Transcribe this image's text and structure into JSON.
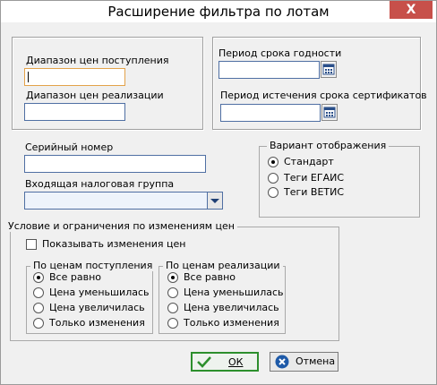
{
  "window": {
    "title": "Расширение фильтра по лотам",
    "close_glyph": "X"
  },
  "left_top": {
    "purchase_price_range_label": "Диапазон цен поступления",
    "purchase_price_range_value": "",
    "sale_price_range_label": "Диапазон цен реализации",
    "sale_price_range_value": ""
  },
  "right_top": {
    "expiry_label": "Период срока годности",
    "expiry_value": "",
    "cert_label": "Период истечения срока сертификатов",
    "cert_value": ""
  },
  "mid": {
    "serial_label": "Серийный номер",
    "serial_value": "",
    "tax_group_label": "Входящая налоговая группа",
    "tax_group_value": ""
  },
  "display": {
    "legend": "Вариант отображения",
    "options": [
      {
        "label": "Стандарт",
        "selected": true
      },
      {
        "label": "Теги ЕГАИС",
        "selected": false
      },
      {
        "label": "Теги ВЕТИС",
        "selected": false
      }
    ]
  },
  "price_changes": {
    "legend": "Условие и ограничения по изменениям цен",
    "show_changes_label": "Показывать изменения цен",
    "show_changes_checked": false,
    "purchase": {
      "legend": "По ценам поступления",
      "options": [
        {
          "label": "Все равно",
          "selected": true
        },
        {
          "label": "Цена уменьшилась",
          "selected": false
        },
        {
          "label": "Цена увеличилась",
          "selected": false
        },
        {
          "label": "Только изменения",
          "selected": false
        }
      ]
    },
    "sale": {
      "legend": "По ценам реализации",
      "options": [
        {
          "label": "Все равно",
          "selected": true
        },
        {
          "label": "Цена уменьшилась",
          "selected": false
        },
        {
          "label": "Цена увеличилась",
          "selected": false
        },
        {
          "label": "Только изменения",
          "selected": false
        }
      ]
    }
  },
  "buttons": {
    "ok_label": "ОК",
    "cancel_label": "Отмена"
  },
  "colors": {
    "ok_accent": "#2d8f2d",
    "cancel_icon": "#1e5aa8",
    "calendar_icon": "#2a4f8a",
    "field_border": "#4f6fa3",
    "focus_border": "#e3a24a"
  }
}
